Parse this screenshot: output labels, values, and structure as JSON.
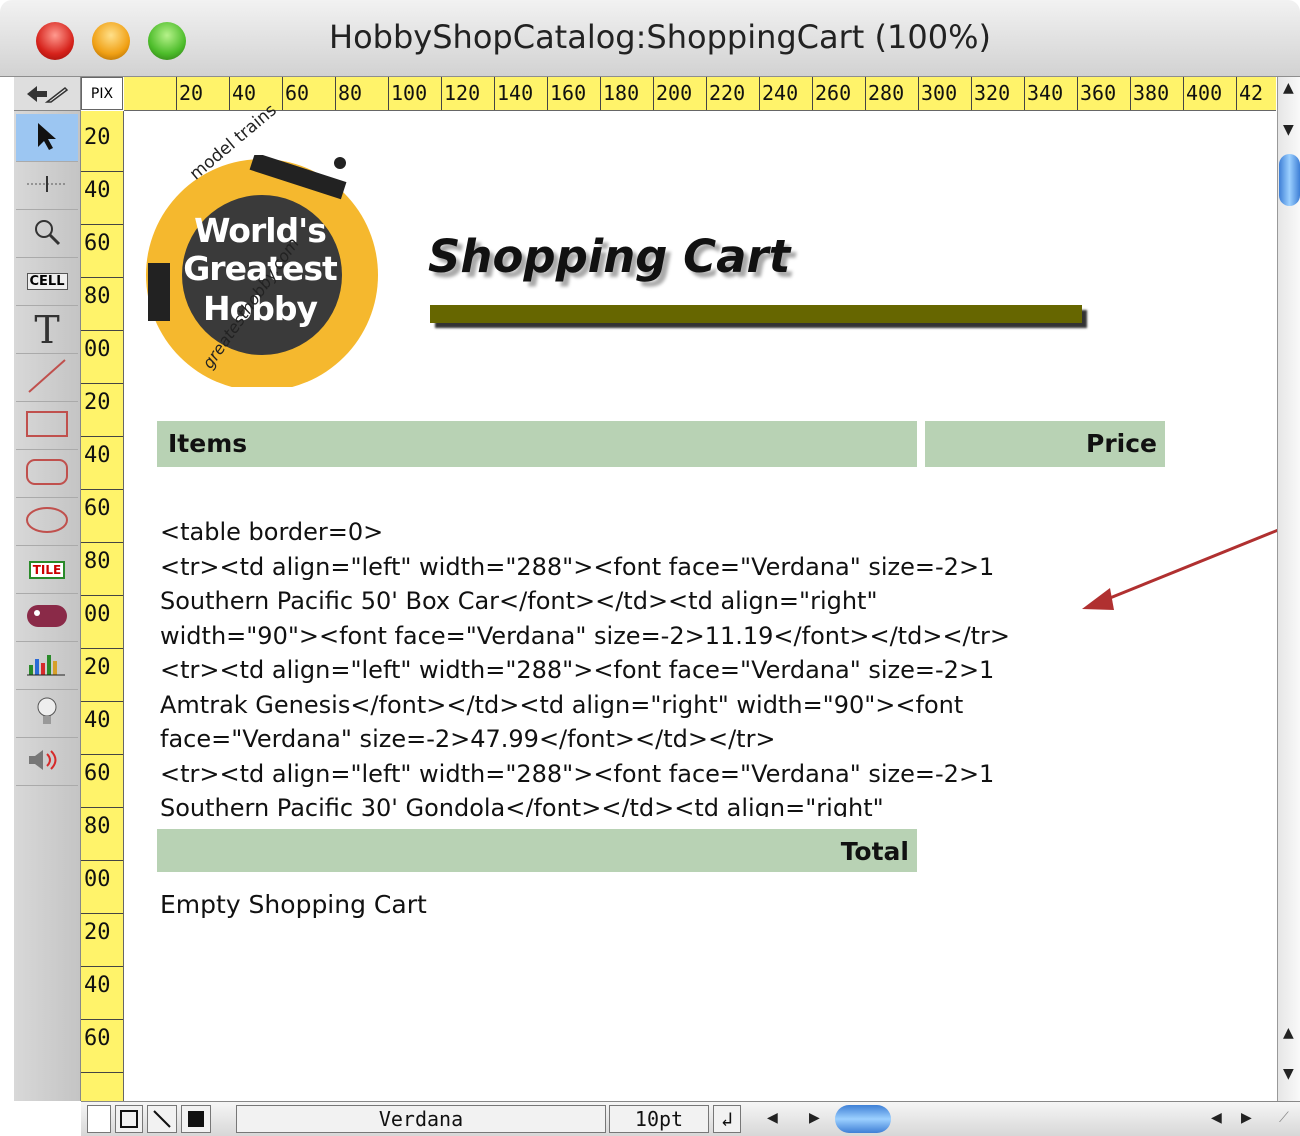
{
  "window": {
    "title": "HobbyShopCatalog:ShoppingCart (100%)"
  },
  "ruler": {
    "unit": "PIX",
    "h_labels": [
      "20",
      "40",
      "60",
      "80",
      "100",
      "120",
      "140",
      "160",
      "180",
      "200",
      "220",
      "240",
      "260",
      "280",
      "300",
      "320",
      "340",
      "360",
      "380",
      "400",
      "42"
    ],
    "v_labels": [
      "20",
      "40",
      "60",
      "80",
      "00",
      "20",
      "40",
      "60",
      "80",
      "00",
      "20",
      "40",
      "60",
      "80",
      "00",
      "20",
      "40",
      "60"
    ]
  },
  "tools": [
    {
      "name": "pointer-tool",
      "icon": "arrow-pointer-icon"
    },
    {
      "name": "crosshair-tool",
      "icon": "crosshair-icon"
    },
    {
      "name": "magnify-tool",
      "icon": "magnifier-icon"
    },
    {
      "name": "cell-tool",
      "icon": "cell-icon",
      "label": "CELL"
    },
    {
      "name": "text-tool",
      "icon": "text-icon",
      "label": "T"
    },
    {
      "name": "line-tool",
      "icon": "line-icon"
    },
    {
      "name": "rectangle-tool",
      "icon": "rectangle-icon"
    },
    {
      "name": "rounded-rectangle-tool",
      "icon": "rounded-rectangle-icon"
    },
    {
      "name": "oval-tool",
      "icon": "oval-icon"
    },
    {
      "name": "tile-tool",
      "icon": "tile-icon",
      "label": "TILE"
    },
    {
      "name": "button-tool",
      "icon": "button-icon"
    },
    {
      "name": "chart-tool",
      "icon": "chart-icon"
    },
    {
      "name": "lightbulb-tool",
      "icon": "lightbulb-icon"
    },
    {
      "name": "sound-tool",
      "icon": "speaker-icon"
    }
  ],
  "logo": {
    "top_text": "model trains",
    "line1": "World's",
    "line2": "Greatest",
    "line3": "Hobby",
    "side_text": "greatesthobby.com",
    "colors": {
      "ring": "#f5b82e",
      "center": "#3a3a3a"
    }
  },
  "page": {
    "heading": "Shopping Cart",
    "items_header": "Items",
    "price_header": "Price",
    "total_label": "Total",
    "empty_cart_link": "Empty Shopping Cart",
    "code_lines": [
      "<table border=0>",
      "<tr><td align=\"left\" width=\"288\"><font face=\"Verdana\" size=-2>1",
      "Southern Pacific 50' Box Car</font></td><td align=\"right\"",
      "width=\"90\"><font face=\"Verdana\" size=-2>11.19</font></td></tr>",
      "<tr><td align=\"left\" width=\"288\"><font face=\"Verdana\" size=-2>1",
      "Amtrak Genesis</font></td><td align=\"right\" width=\"90\"><font",
      "face=\"Verdana\" size=-2>47.99</font></td></tr>",
      "<tr><td align=\"left\" width=\"288\"><font face=\"Verdana\" size=-2>1",
      "Southern Pacific 30' Gondola</font></td><td align=\"right\""
    ]
  },
  "statusbar": {
    "font_name": "Verdana",
    "font_size": "10pt"
  },
  "colors": {
    "header_fill": "#b8d2b4",
    "heading_bar": "#666600",
    "ruler": "#fff36a",
    "arrow": "#b03030"
  }
}
